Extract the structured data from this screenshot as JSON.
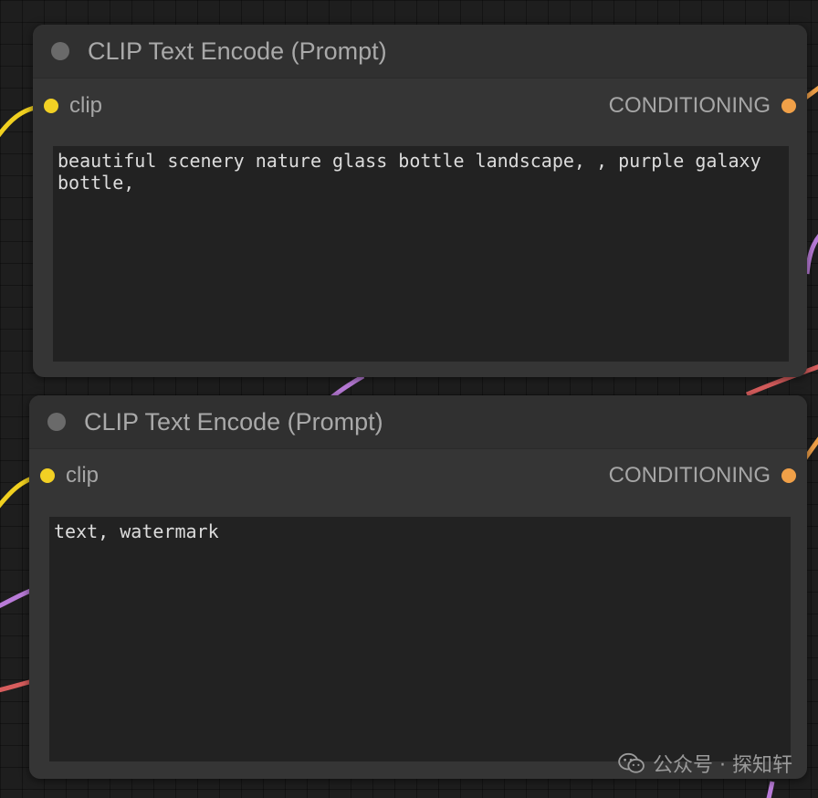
{
  "colors": {
    "clip_slot": "#f2d024",
    "conditioning_slot": "#f0a048",
    "wire_yellow": "#f0d020",
    "wire_purple": "#b97bd8",
    "wire_red": "#d75d5d",
    "wire_orange": "#f0a048"
  },
  "nodes": [
    {
      "title": "CLIP Text Encode (Prompt)",
      "input_label": "clip",
      "output_label": "CONDITIONING",
      "text": "beautiful scenery nature glass bottle landscape, , purple galaxy bottle,"
    },
    {
      "title": "CLIP Text Encode (Prompt)",
      "input_label": "clip",
      "output_label": "CONDITIONING",
      "text": "text, watermark"
    }
  ],
  "watermark": {
    "icon": "wechat-icon",
    "text": "公众号 · 探知轩"
  }
}
